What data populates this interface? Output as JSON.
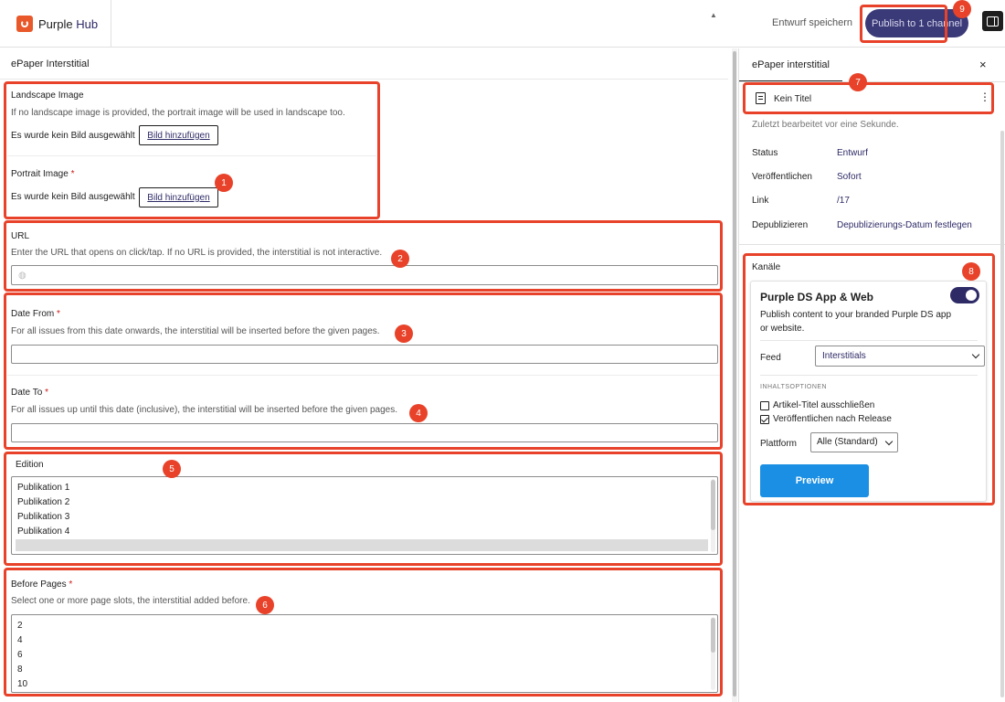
{
  "header": {
    "brand": "Purple",
    "brand_suffix": "Hub",
    "save_draft": "Entwurf speichern",
    "publish": "Publish to 1 channel"
  },
  "editor": {
    "section_title": "ePaper Interstitial",
    "landscape": {
      "label": "Landscape Image",
      "help": "If no landscape image is provided, the portrait image will be used in landscape too.",
      "no_image": "Es wurde kein Bild ausgewählt",
      "button": "Bild hinzufügen"
    },
    "portrait": {
      "label": "Portrait Image",
      "no_image": "Es wurde kein Bild ausgewählt",
      "button": "Bild hinzufügen"
    },
    "url": {
      "label": "URL",
      "help": "Enter the URL that opens on click/tap. If no URL is provided, the interstitial is not interactive."
    },
    "date_from": {
      "label": "Date From",
      "help": "For all issues from this date onwards, the interstitial will be inserted before the given pages."
    },
    "date_to": {
      "label": "Date To",
      "help": "For all issues up until this date (inclusive), the interstitial will be inserted before the given pages."
    },
    "edition": {
      "label": "Edition",
      "options": [
        "Publikation 1",
        "Publikation 2",
        "Publikation 3",
        "Publikation 4"
      ]
    },
    "before_pages": {
      "label": "Before Pages",
      "help": "Select one or more page slots, the interstitial added before.",
      "options": [
        "2",
        "4",
        "6",
        "8",
        "10"
      ]
    },
    "required_mark": "*"
  },
  "sidebar": {
    "tab": "ePaper interstitial",
    "close": "×",
    "doc_title": "Kein Titel",
    "more": "⋮",
    "last_edited": "Zuletzt bearbeitet vor eine Sekunde.",
    "meta": [
      {
        "key": "Status",
        "value": "Entwurf"
      },
      {
        "key": "Veröffentlichen",
        "value": "Sofort"
      },
      {
        "key": "Link",
        "value": "/17"
      },
      {
        "key": "Depublizieren",
        "value": "Depublizierungs-Datum festlegen"
      }
    ],
    "channels": {
      "title": "Kanäle",
      "name": "Purple DS App & Web",
      "toggle_on": true,
      "description": "Publish content to your branded Purple DS app or website.",
      "feed_label": "Feed",
      "feed_value": "Interstitials",
      "options_caption": "INHALTSOPTIONEN",
      "option_exclude_title": "Artikel-Titel ausschließen",
      "option_exclude_title_checked": false,
      "option_publish_after_release": "Veröffentlichen nach Release",
      "option_publish_after_release_checked": true,
      "platform_label": "Plattform",
      "platform_value": "Alle (Standard)",
      "preview": "Preview"
    }
  },
  "annotations": [
    "1",
    "2",
    "3",
    "4",
    "5",
    "6",
    "7",
    "8",
    "9"
  ],
  "colors": {
    "annotation": "#e8432a",
    "publish": "#3b3a78",
    "preview": "#1a8fe3",
    "link": "#2d2a66"
  }
}
